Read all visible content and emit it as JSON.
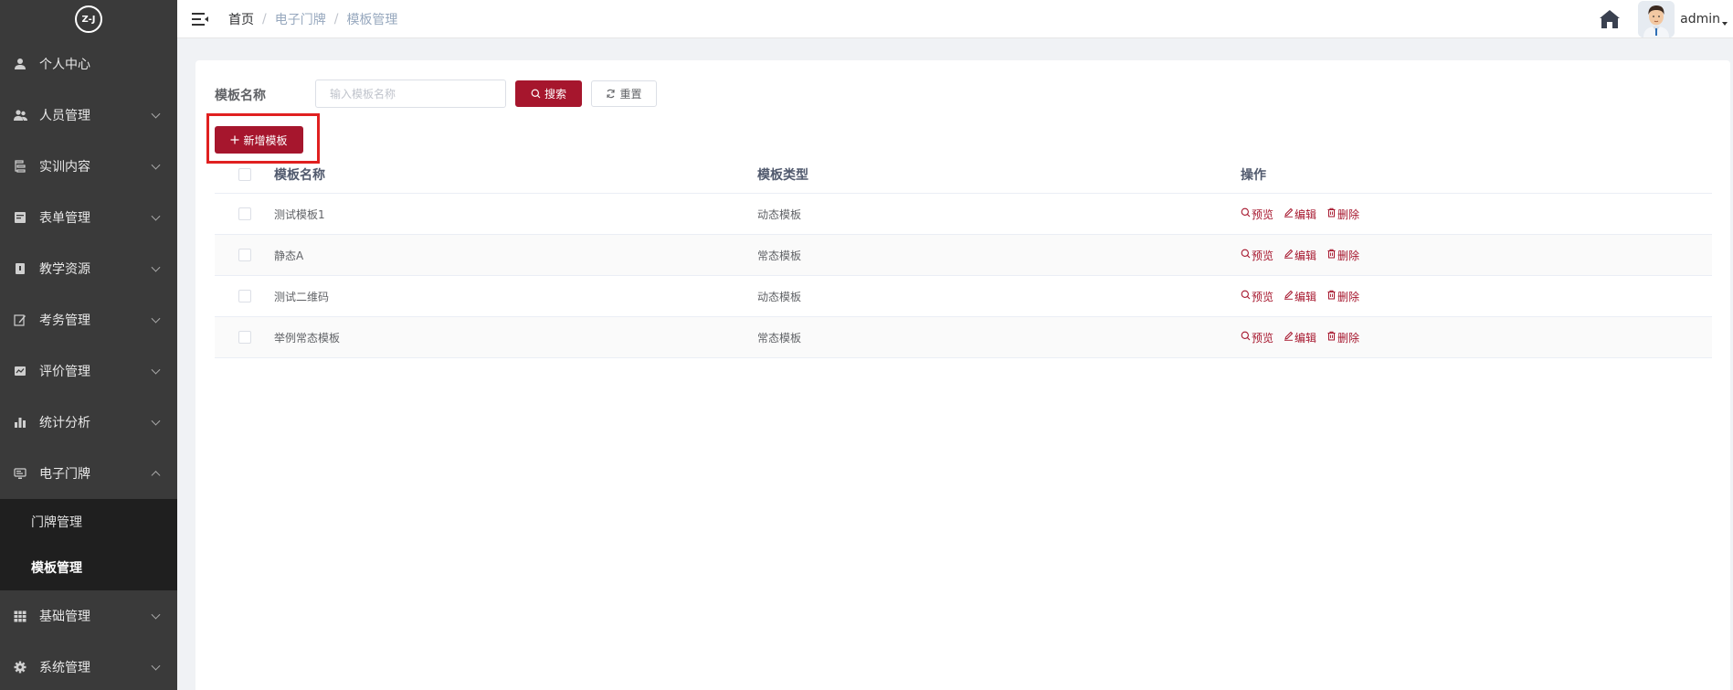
{
  "logo": {
    "text": "Z-J"
  },
  "sidebar": {
    "items": [
      {
        "label": "个人中心",
        "icon": "user-icon",
        "has_arrow": false
      },
      {
        "label": "人员管理",
        "icon": "users-icon",
        "has_arrow": true
      },
      {
        "label": "实训内容",
        "icon": "list-icon",
        "has_arrow": true
      },
      {
        "label": "表单管理",
        "icon": "form-icon",
        "has_arrow": true
      },
      {
        "label": "教学资源",
        "icon": "book-icon",
        "has_arrow": true
      },
      {
        "label": "考务管理",
        "icon": "edit-icon",
        "has_arrow": true
      },
      {
        "label": "评价管理",
        "icon": "rating-icon",
        "has_arrow": true
      },
      {
        "label": "统计分析",
        "icon": "bar-chart-icon",
        "has_arrow": true
      },
      {
        "label": "电子门牌",
        "icon": "monitor-icon",
        "has_arrow": true,
        "expanded": true
      }
    ],
    "submenu": [
      {
        "label": "门牌管理",
        "active": false
      },
      {
        "label": "模板管理",
        "active": true
      }
    ],
    "items_after": [
      {
        "label": "基础管理",
        "icon": "grid-icon"
      },
      {
        "label": "系统管理",
        "icon": "gear-icon"
      }
    ]
  },
  "header": {
    "breadcrumb": [
      "首页",
      "电子门牌",
      "模板管理"
    ],
    "username": "admin"
  },
  "search": {
    "label": "模板名称",
    "placeholder": "输入模板名称",
    "value": "",
    "search_label": "搜索",
    "reset_label": "重置"
  },
  "actions": {
    "add_label": "新增模板"
  },
  "table": {
    "columns": [
      "模板名称",
      "模板类型",
      "操作"
    ],
    "rows": [
      {
        "name": "测试模板1",
        "type": "动态模板"
      },
      {
        "name": "静态A",
        "type": "常态模板"
      },
      {
        "name": "测试二维码",
        "type": "动态模板"
      },
      {
        "name": "举例常态模板",
        "type": "常态模板"
      }
    ],
    "ops": {
      "preview": "预览",
      "edit": "编辑",
      "delete": "删除"
    }
  },
  "colors": {
    "accent": "#a6162d",
    "sidebar_bg": "#3a3a3a",
    "submenu_bg": "#1f1f1f",
    "highlight": "#e02020"
  }
}
